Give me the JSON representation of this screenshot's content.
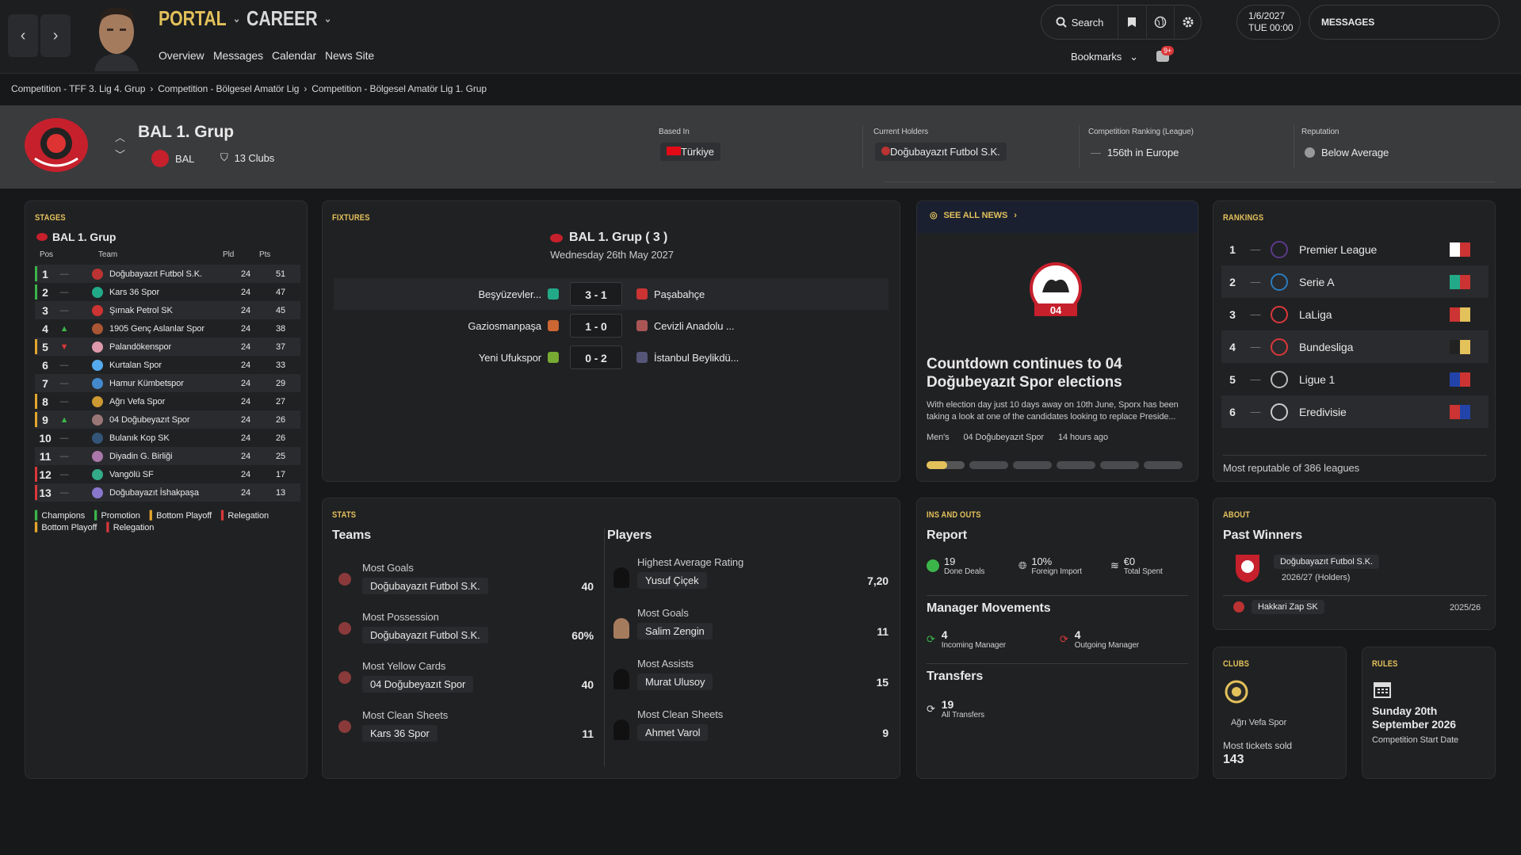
{
  "topbar": {
    "portal": "PORTAL",
    "career": "CAREER",
    "nav": [
      "Overview",
      "Messages",
      "Calendar",
      "News Site"
    ],
    "search": "Search",
    "bookmarks": "Bookmarks",
    "badge": "9+",
    "date_line1": "1/6/2027",
    "date_line2": "TUE 00:00",
    "messages": "MESSAGES"
  },
  "breadcrumb": [
    "Competition - TFF 3. Lig 4. Grup",
    "Competition - Bölgesel Amatör Lig",
    "Competition - Bölgesel Amatör Lig 1. Grup"
  ],
  "header": {
    "title": "BAL 1. Grup",
    "short": "BAL",
    "clubs": "13 Clubs",
    "based_in_label": "Based In",
    "based_in": "Türkiye",
    "holders_label": "Current Holders",
    "holders": "Doğubayazıt Futbol S.K.",
    "ranking_label": "Competition Ranking (League)",
    "ranking": "156th in Europe",
    "reputation_label": "Reputation",
    "reputation": "Below Average"
  },
  "stages": {
    "title": "STAGES",
    "group": "BAL 1. Grup",
    "cols": [
      "Pos",
      "Team",
      "Pld",
      "Pts"
    ],
    "rows": [
      {
        "pos": "1",
        "trend": "—",
        "team": "Doğubayazıt Futbol S.K.",
        "pld": "24",
        "pts": "51",
        "mark": "#3bb54a"
      },
      {
        "pos": "2",
        "trend": "—",
        "team": "Kars 36 Spor",
        "pld": "24",
        "pts": "47",
        "mark": "#3bb54a"
      },
      {
        "pos": "3",
        "trend": "—",
        "team": "Şırnak Petrol SK",
        "pld": "24",
        "pts": "45",
        "mark": ""
      },
      {
        "pos": "4",
        "trend": "up",
        "team": "1905 Genç Aslanlar Spor",
        "pld": "24",
        "pts": "38",
        "mark": ""
      },
      {
        "pos": "5",
        "trend": "down",
        "team": "Palandökenspor",
        "pld": "24",
        "pts": "37",
        "mark": "#e3a62b"
      },
      {
        "pos": "6",
        "trend": "—",
        "team": "Kurtalan Spor",
        "pld": "24",
        "pts": "33",
        "mark": ""
      },
      {
        "pos": "7",
        "trend": "—",
        "team": "Hamur Kümbetspor",
        "pld": "24",
        "pts": "29",
        "mark": ""
      },
      {
        "pos": "8",
        "trend": "—",
        "team": "Ağrı Vefa Spor",
        "pld": "24",
        "pts": "27",
        "mark": "#e3a62b"
      },
      {
        "pos": "9",
        "trend": "up",
        "team": "04 Doğubeyazıt Spor",
        "pld": "24",
        "pts": "26",
        "mark": "#e3a62b"
      },
      {
        "pos": "10",
        "trend": "—",
        "team": "Bulanık Kop SK",
        "pld": "24",
        "pts": "26",
        "mark": ""
      },
      {
        "pos": "11",
        "trend": "—",
        "team": "Diyadin G. Birliği",
        "pld": "24",
        "pts": "25",
        "mark": ""
      },
      {
        "pos": "12",
        "trend": "—",
        "team": "Vangölü SF",
        "pld": "24",
        "pts": "17",
        "mark": "#d9383a"
      },
      {
        "pos": "13",
        "trend": "—",
        "team": "Doğubayazıt İshakpaşa",
        "pld": "24",
        "pts": "13",
        "mark": "#d9383a"
      }
    ],
    "legend": [
      "Champions",
      "Promotion",
      "Bottom Playoff",
      "Relegation",
      "Bottom Playoff",
      "Relegation"
    ]
  },
  "fixtures": {
    "title": "FIXTURES",
    "group": "BAL 1. Grup  ( 3 )",
    "date": "Wednesday 26th May 2027",
    "matches": [
      {
        "home": "Beşyüzevler...",
        "score": "3 - 1",
        "away": "Paşabahçe"
      },
      {
        "home": "Gaziosmanpaşa",
        "score": "1 - 0",
        "away": "Cevizli Anadolu ..."
      },
      {
        "home": "Yeni Ufukspor",
        "score": "0 - 2",
        "away": "İstanbul Beylikdü..."
      }
    ]
  },
  "news": {
    "see_all": "SEE ALL NEWS",
    "headline": "Countdown continues to 04 Doğubeyazıt Spor elections",
    "body": "With election day just 10 days away on 10th June, Sporx has been taking a look at one of the candidates looking to replace Preside...",
    "tags": [
      "Men's",
      "04 Doğubeyazıt Spor",
      "14 hours ago"
    ],
    "logo_text": "04"
  },
  "rankings": {
    "title": "RANKINGS",
    "rows": [
      {
        "rank": "1",
        "name": "Premier League"
      },
      {
        "rank": "2",
        "name": "Serie A"
      },
      {
        "rank": "3",
        "name": "LaLiga"
      },
      {
        "rank": "4",
        "name": "Bundesliga"
      },
      {
        "rank": "5",
        "name": "Ligue 1"
      },
      {
        "rank": "6",
        "name": "Eredivisie"
      }
    ],
    "footer": "Most reputable of 386 leagues"
  },
  "stats": {
    "title": "STATS",
    "teams_h": "Teams",
    "players_h": "Players",
    "teams": [
      {
        "label": "Most Goals",
        "name": "Doğubayazıt Futbol S.K.",
        "val": "40"
      },
      {
        "label": "Most Possession",
        "name": "Doğubayazıt Futbol S.K.",
        "val": "60%"
      },
      {
        "label": "Most Yellow Cards",
        "name": "04 Doğubeyazıt Spor",
        "val": "40"
      },
      {
        "label": "Most Clean Sheets",
        "name": "Kars 36 Spor",
        "val": "11"
      }
    ],
    "players": [
      {
        "label": "Highest Average Rating",
        "name": "Yusuf Çiçek",
        "val": "7,20"
      },
      {
        "label": "Most Goals",
        "name": "Salim Zengin",
        "val": "11"
      },
      {
        "label": "Most Assists",
        "name": "Murat Ulusoy",
        "val": "15"
      },
      {
        "label": "Most Clean Sheets",
        "name": "Ahmet Varol",
        "val": "9"
      }
    ]
  },
  "insouts": {
    "title": "INS AND OUTS",
    "report": "Report",
    "done": "19",
    "done_l": "Done Deals",
    "foreign": "10%",
    "foreign_l": "Foreign Import",
    "spent": "€0",
    "spent_l": "Total Spent",
    "mm": "Manager Movements",
    "inc": "4",
    "inc_l": "Incoming Manager",
    "out": "4",
    "out_l": "Outgoing Manager",
    "transfers": "Transfers",
    "tr": "19",
    "tr_l": "All Transfers"
  },
  "about": {
    "title": "ABOUT",
    "past": "Past Winners",
    "w1": "Doğubayazıt Futbol S.K.",
    "w1s": "2026/27",
    "w1h": "(Holders)",
    "w2": "Hakkari Zap SK",
    "w2s": "2025/26"
  },
  "clubs": {
    "title": "CLUBS",
    "club": "Ağrı Vefa Spor",
    "label": "Most tickets sold",
    "value": "143"
  },
  "rules": {
    "title": "RULES",
    "date": "Sunday 20th September 2026",
    "label": "Competition Start Date"
  },
  "colors": {
    "accent": "#e3c15b",
    "green": "#3bb54a",
    "red": "#d9383a",
    "orange": "#e3a62b"
  }
}
